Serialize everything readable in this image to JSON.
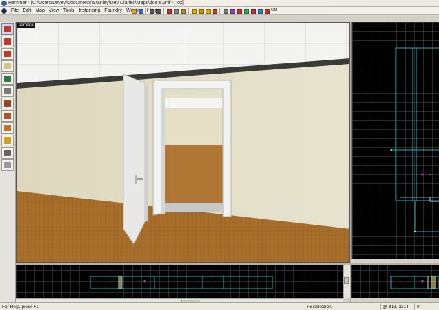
{
  "window": {
    "title": "Hammer - [C:\\Users\\Davey\\Documents\\Stanley\\Dev Diaries\\Maps\\doors.vmf - Top]"
  },
  "menu": {
    "items": [
      "File",
      "Edit",
      "Map",
      "View",
      "Tools",
      "Instancing",
      "Foundry",
      "Window",
      "Help"
    ]
  },
  "toolbar": {
    "buttons": [
      {
        "icon": "open-icon",
        "color": "#d9a32a"
      },
      {
        "icon": "save-icon",
        "color": "#3b6fb6"
      },
      {
        "icon": "undo-icon",
        "color": "#555555"
      },
      {
        "icon": "redo-icon",
        "color": "#555555"
      },
      {
        "icon": "cut-icon",
        "color": "#c0392b"
      },
      {
        "icon": "copy-icon",
        "color": "#888888"
      },
      {
        "icon": "paste-icon",
        "color": "#b58b3a"
      },
      {
        "icon": "group-icon",
        "color": "#d9b000"
      },
      {
        "icon": "ungroup-icon",
        "color": "#c49a00"
      },
      {
        "icon": "hide-icon",
        "color": "#d9b000"
      },
      {
        "icon": "stop-icon",
        "color": "#c0392b"
      },
      {
        "icon": "grid-icon",
        "color": "#777777"
      },
      {
        "icon": "texture-icon",
        "color": "#8e44ad"
      },
      {
        "icon": "carve-icon",
        "color": "#c0392b"
      },
      {
        "icon": "entity-icon",
        "color": "#27ae60"
      },
      {
        "icon": "run-icon",
        "color": "#c0392b"
      },
      {
        "icon": "compile-icon",
        "color": "#2e86c1"
      },
      {
        "icon": "model-icon",
        "color": "#c0392b"
      }
    ],
    "cm_label": "CM"
  },
  "palette": {
    "tools": [
      {
        "name": "selection-tool-icon",
        "color": "#c0392b"
      },
      {
        "name": "magnify-tool-icon",
        "color": "#c0392b"
      },
      {
        "name": "camera-tool-icon",
        "color": "#c0392b"
      },
      {
        "name": "entity-tool-icon",
        "color": "#d4c28a"
      },
      {
        "name": "block-tool-icon",
        "color": "#2c7a4b"
      },
      {
        "name": "texture-tool-icon",
        "color": "#7a7a7a"
      },
      {
        "name": "apply-texture-tool-icon",
        "color": "#a04020"
      },
      {
        "name": "decal-tool-icon",
        "color": "#b0502a"
      },
      {
        "name": "overlay-tool-icon",
        "color": "#c07030"
      },
      {
        "name": "clip-tool-icon",
        "color": "#d4a017"
      },
      {
        "name": "vertex-tool-icon",
        "color": "#666666"
      },
      {
        "name": "path-tool-icon",
        "color": "#999999"
      }
    ]
  },
  "views": {
    "camera_label": "camera"
  },
  "status": {
    "help": "For Help, press F1",
    "selection": "no selection.",
    "coords": "@-813, 1314",
    "zoom": "0"
  }
}
